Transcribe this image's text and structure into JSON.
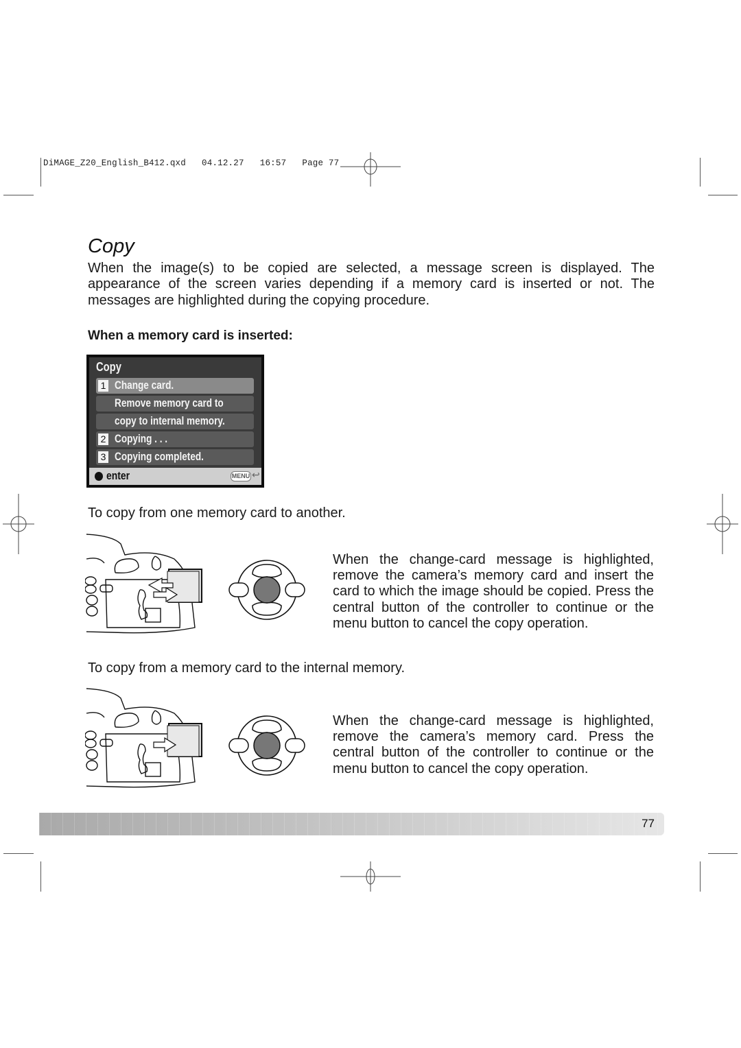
{
  "slug": {
    "file": "DiMAGE_Z20_English_B412.qxd",
    "date": "04.12.27",
    "time": "16:57",
    "page_label": "Page 77"
  },
  "title": "Copy",
  "intro": "When the image(s) to be copied are selected, a message screen is displayed. The appearance of the screen varies depending if a memory card is inserted or not. The messages are highlighted during the copying procedure.",
  "subhead": "When a memory card is inserted:",
  "lcd": {
    "title": "Copy",
    "rows": [
      {
        "num": "1",
        "text": "Change card.",
        "highlighted": true
      },
      {
        "num": "",
        "text": "Remove memory card to",
        "highlighted": false
      },
      {
        "num": "",
        "text": "copy to internal memory.",
        "highlighted": false
      },
      {
        "num": "2",
        "text": "Copying . . .",
        "highlighted": false
      },
      {
        "num": "3",
        "text": "Copying completed.",
        "highlighted": false
      }
    ],
    "footer": {
      "enter_label": "enter",
      "menu_label": "MENU",
      "return_icon": "↩"
    }
  },
  "sections": [
    {
      "caption": "To copy from one memory card to another.",
      "description": "When the change-card message is highlighted, remove the camera’s memory card and insert the card to which the image should be copied. Press the central button of the controller to continue or the menu button to cancel the copy operation.",
      "illustration": "camera-card-swap",
      "controller": "controller-center-pressed"
    },
    {
      "caption": "To copy from a memory card to  the internal memory.",
      "description": "When the change-card message is highlighted, remove the camera’s memory card. Press the central button of the controller to continue or the menu button to cancel the copy operation.",
      "illustration": "camera-card-remove",
      "controller": "controller-center-pressed"
    }
  ],
  "footer": {
    "page_number": "77"
  }
}
